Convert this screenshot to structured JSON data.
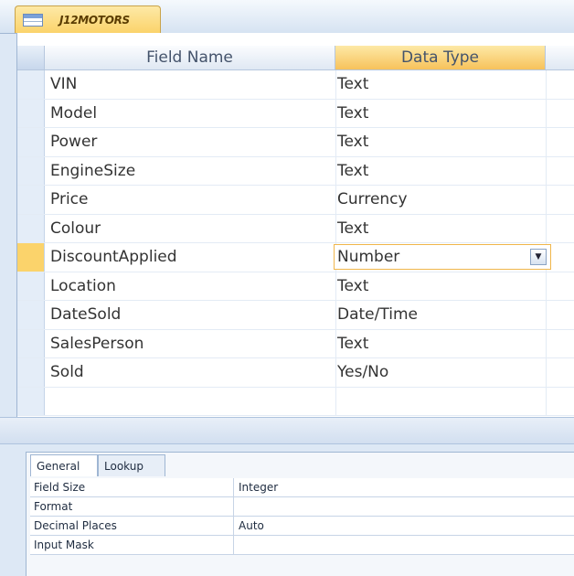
{
  "document_tab": {
    "label": "J12MOTORS"
  },
  "grid": {
    "columns": [
      "Field Name",
      "Data Type"
    ],
    "fields": [
      {
        "name": "VIN",
        "type": "Text"
      },
      {
        "name": "Model",
        "type": "Text"
      },
      {
        "name": "Power",
        "type": "Text"
      },
      {
        "name": "EngineSize",
        "type": "Text"
      },
      {
        "name": "Price",
        "type": "Currency"
      },
      {
        "name": "Colour",
        "type": "Text"
      },
      {
        "name": "DiscountApplied",
        "type": "Number"
      },
      {
        "name": "Location",
        "type": "Text"
      },
      {
        "name": "DateSold",
        "type": "Date/Time"
      },
      {
        "name": "SalesPerson",
        "type": "Text"
      },
      {
        "name": "Sold",
        "type": "Yes/No"
      },
      {
        "name": "",
        "type": ""
      }
    ],
    "current_row": 6
  },
  "properties": {
    "tabs": [
      "General",
      "Lookup"
    ],
    "rows": [
      {
        "name": "Field Size",
        "value": "Integer"
      },
      {
        "name": "Format",
        "value": ""
      },
      {
        "name": "Decimal Places",
        "value": "Auto"
      },
      {
        "name": "Input Mask",
        "value": ""
      }
    ]
  },
  "colors": {
    "accent": "#fbd36b",
    "header_bg": "#dfe8f3",
    "border": "#9fb6d3"
  },
  "icons": {
    "document_tab": "table-icon",
    "dropdown": "chevron-down-icon"
  }
}
